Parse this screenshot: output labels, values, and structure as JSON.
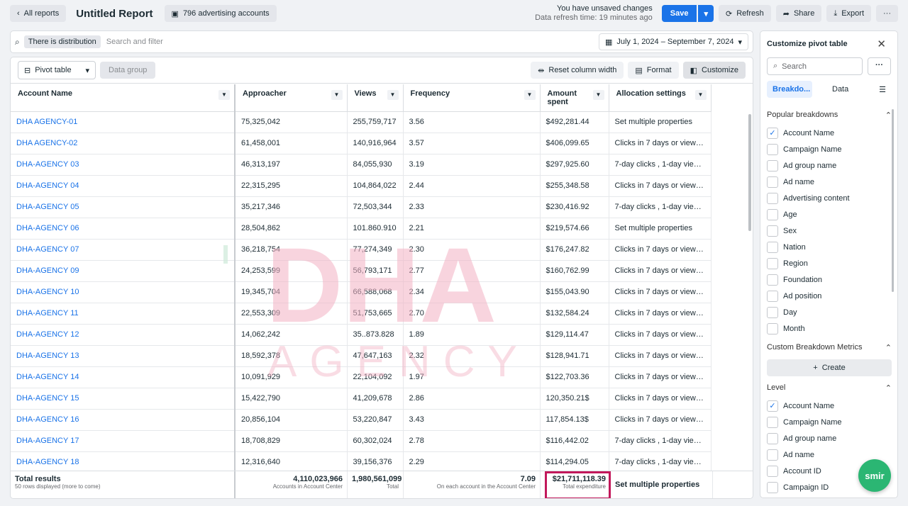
{
  "topbar": {
    "back_label": "All reports",
    "title": "Untitled Report",
    "accounts_badge": "796 advertising accounts",
    "unsaved": "You have unsaved changes",
    "refresh_time": "Data refresh time: 19 minutes ago",
    "save": "Save",
    "refresh": "Refresh",
    "share": "Share",
    "export": "Export",
    "more": "···"
  },
  "filter": {
    "chip": "There is distribution",
    "placeholder": "Search and filter",
    "date_range": "July 1, 2024 – September 7, 2024"
  },
  "toolbar": {
    "view": "Pivot table",
    "data_group": "Data group",
    "reset": "Reset column width",
    "format": "Format",
    "customize": "Customize"
  },
  "table": {
    "headers": [
      "Account Name",
      "Approacher",
      "Views",
      "Frequency",
      "Amount spent",
      "Allocation settings"
    ],
    "rows": [
      [
        "DHA AGENCY-01",
        "75,325,042",
        "255,759,717",
        "3.56",
        "$492,281.44",
        "Set multiple properties"
      ],
      [
        "DHA AGENCY-02",
        "61,458,001",
        "140,916,964",
        "3.57",
        "$406,099.65",
        "Clicks in 7 days or views i..."
      ],
      [
        "DHA-AGENCY 03",
        "46,313,197",
        "84,055,930",
        "3.19",
        "$297,925.60",
        "7-day clicks , 1-day views ..."
      ],
      [
        "DHA-AGENCY 04",
        "22,315,295",
        "104,864,022",
        "2.44",
        "$255,348.58",
        "Clicks in 7 days or views i..."
      ],
      [
        "DHA-AGENCY 05",
        "35,217,346",
        "72,503,344",
        "2.33",
        "$230,416.92",
        "7-day clicks , 1-day views ..."
      ],
      [
        "DHA-AGENCY 06",
        "28,504,862",
        "101.860.910",
        "2.21",
        "$219,574.66",
        "Set multiple properties"
      ],
      [
        "DHA-AGENCY 07",
        "36,218,754",
        "77,274,349",
        "2.30",
        "$176,247.82",
        "Clicks in 7 days or views i..."
      ],
      [
        "DHA-AGENCY 09",
        "24,253,599",
        "56,793,171",
        "2.77",
        "$160,762.99",
        "Clicks in 7 days or views i..."
      ],
      [
        "DHA-AGENCY 10",
        "19,345,704",
        "66,588,068",
        "2.34",
        "$155,043.90",
        "Clicks in 7 days or views i..."
      ],
      [
        "DHA-AGENCY 11",
        "22,553,309",
        "51,753,665",
        "2.70",
        "$132,584.24",
        "Clicks in 7 days or views i..."
      ],
      [
        "DHA-AGENCY 12",
        "14,062,242",
        "35..873.828",
        "1.89",
        "$129,114.47",
        "Clicks in 7 days or views i..."
      ],
      [
        "DHA-AGENCY 13",
        "18,592,378",
        "47,647,163",
        "2.32",
        "$128,941.71",
        "Clicks in 7 days or views i..."
      ],
      [
        "DHA-AGENCY 14",
        "10,091,929",
        "22,104,092",
        "1.97",
        "$122,703.36",
        "Clicks in 7 days or views i..."
      ],
      [
        "DHA-AGENCY 15",
        "15,422,790",
        "41,209,678",
        "2.86",
        "120,350.21$",
        "Clicks in 7 days or views i..."
      ],
      [
        "DHA-AGENCY 16",
        "20,856,104",
        "53,220,847",
        "3.43",
        "117,854.13$",
        "Clicks in 7 days or views i..."
      ],
      [
        "DHA-AGENCY 17",
        "18,708,829",
        "60,302,024",
        "2.78",
        "$116,442.02",
        "7-day clicks , 1-day views ..."
      ],
      [
        "DHA-AGENCY 18",
        "12,316,640",
        "39,156,376",
        "2.29",
        "$114,294.05",
        "7-day clicks , 1-day views ..."
      ]
    ]
  },
  "footer": {
    "label": "Total results",
    "sublabel": "50 rows displayed (more to come)",
    "approacher": "4,110,023,966",
    "approacher_sub": "Accounts in Account Center",
    "views": "1,980,561,099",
    "views_sub": "Total",
    "frequency": "7.09",
    "frequency_sub": "On each account in the Account Center",
    "amount": "$21,711,118.39",
    "amount_sub": "Total expenditure",
    "allocation": "Set multiple properties"
  },
  "watermark": {
    "line1": "DHA",
    "line2": "AGENCY"
  },
  "panel": {
    "title": "Customize pivot table",
    "search_placeholder": "Search",
    "more": "···",
    "tabs": [
      "Breakdo...",
      "Data"
    ],
    "popular_title": "Popular breakdowns",
    "popular": [
      {
        "label": "Account Name",
        "checked": true
      },
      {
        "label": "Campaign Name",
        "checked": false
      },
      {
        "label": "Ad group name",
        "checked": false
      },
      {
        "label": "Ad name",
        "checked": false
      },
      {
        "label": "Advertising content",
        "checked": false
      },
      {
        "label": "Age",
        "checked": false
      },
      {
        "label": "Sex",
        "checked": false
      },
      {
        "label": "Nation",
        "checked": false
      },
      {
        "label": "Region",
        "checked": false
      },
      {
        "label": "Foundation",
        "checked": false
      },
      {
        "label": "Ad position",
        "checked": false
      },
      {
        "label": "Day",
        "checked": false
      },
      {
        "label": "Month",
        "checked": false
      }
    ],
    "custom_title": "Custom Breakdown Metrics",
    "create": "Create",
    "level_title": "Level",
    "level": [
      {
        "label": "Account Name",
        "checked": true
      },
      {
        "label": "Campaign Name",
        "checked": false
      },
      {
        "label": "Ad group name",
        "checked": false
      },
      {
        "label": "Ad name",
        "checked": false
      },
      {
        "label": "Account ID",
        "checked": false
      },
      {
        "label": "Campaign ID",
        "checked": false
      }
    ]
  },
  "fab": "smir",
  "colors": {
    "accent": "#1a73e8",
    "highlight": "#c2185b",
    "fab": "#2bb673"
  }
}
